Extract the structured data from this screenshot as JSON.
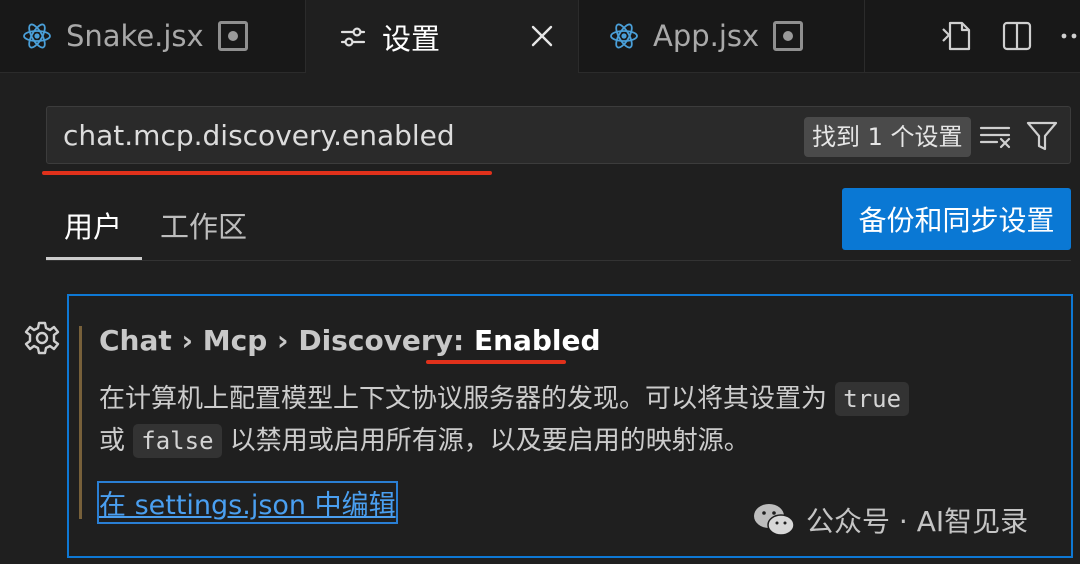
{
  "tabs": [
    {
      "label": "Snake.jsx",
      "icon": "react-icon",
      "dirty": true
    },
    {
      "label": "设置",
      "icon": "sliders-icon",
      "active": true
    },
    {
      "label": "App.jsx",
      "icon": "react-icon",
      "dirty": true
    }
  ],
  "search": {
    "value": "chat.mcp.discovery.enabled",
    "result_count": "找到 1 个设置"
  },
  "scopes": {
    "user": "用户",
    "workspace": "工作区",
    "sync_button": "备份和同步设置"
  },
  "setting": {
    "breadcrumb": "Chat › Mcp › Discovery: ",
    "key": "Enabled",
    "desc_line1": "在计算机上配置模型上下文协议服务器的发现。可以将其设置为",
    "code_true": "true",
    "desc_line2_pre": "或",
    "code_false": "false",
    "desc_line2_post": "以禁用或启用所有源，以及要启用的映射源。",
    "edit_link": "在 settings.json 中编辑"
  },
  "watermark": "公众号 · AI智见录",
  "colors": {
    "accent": "#0a78d4",
    "highlight_underline": "#e0311b",
    "modified_bar": "#77603a"
  }
}
